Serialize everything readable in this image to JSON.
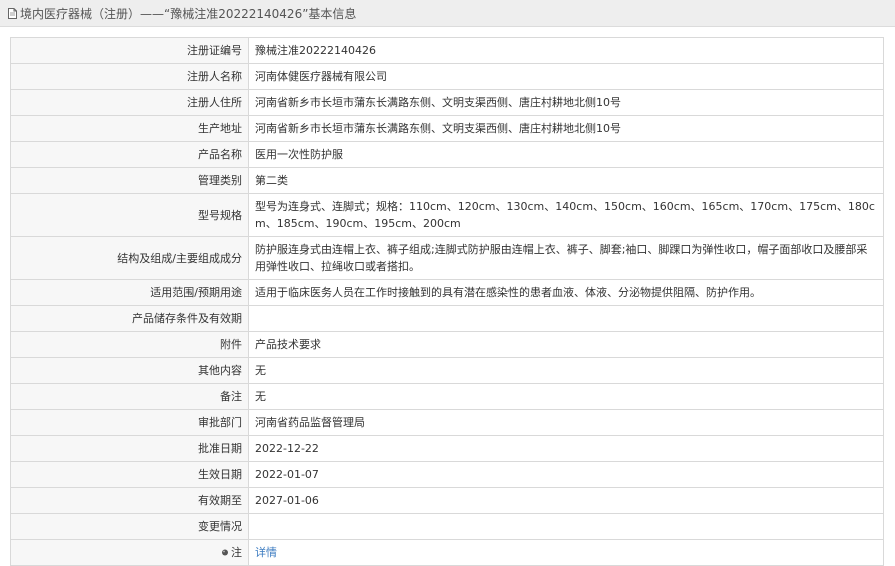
{
  "header": {
    "title": "境内医疗器械（注册）——“豫械注准20222140426”基本信息"
  },
  "rows": [
    {
      "label": "注册证编号",
      "value": "豫械注准20222140426"
    },
    {
      "label": "注册人名称",
      "value": "河南体健医疗器械有限公司"
    },
    {
      "label": "注册人住所",
      "value": "河南省新乡市长垣市蒲东长满路东侧、文明支渠西侧、唐庄村耕地北侧10号"
    },
    {
      "label": "生产地址",
      "value": "河南省新乡市长垣市蒲东长满路东侧、文明支渠西侧、唐庄村耕地北侧10号"
    },
    {
      "label": "产品名称",
      "value": "医用一次性防护服"
    },
    {
      "label": "管理类别",
      "value": "第二类"
    },
    {
      "label": "型号规格",
      "value": "型号为连身式、连脚式；规格：110cm、120cm、130cm、140cm、150cm、160cm、165cm、170cm、175cm、180cm、185cm、190cm、195cm、200cm"
    },
    {
      "label": "结构及组成/主要组成成分",
      "value": "防护服连身式由连帽上衣、裤子组成;连脚式防护服由连帽上衣、裤子、脚套;袖口、脚踝口为弹性收口，帽子面部收口及腰部采用弹性收口、拉绳收口或者搭扣。"
    },
    {
      "label": "适用范围/预期用途",
      "value": "适用于临床医务人员在工作时接触到的具有潜在感染性的患者血液、体液、分泌物提供阻隔、防护作用。"
    },
    {
      "label": "产品储存条件及有效期",
      "value": ""
    },
    {
      "label": "附件",
      "value": "产品技术要求"
    },
    {
      "label": "其他内容",
      "value": "无"
    },
    {
      "label": "备注",
      "value": "无"
    },
    {
      "label": "审批部门",
      "value": "河南省药品监督管理局"
    },
    {
      "label": "批准日期",
      "value": "2022-12-22"
    },
    {
      "label": "生效日期",
      "value": "2022-01-07"
    },
    {
      "label": "有效期至",
      "value": "2027-01-06"
    },
    {
      "label": "变更情况",
      "value": ""
    }
  ],
  "note_row": {
    "label": "注",
    "link_text": "详情"
  },
  "colors": {
    "link": "#3a7ac0",
    "header_bg": "#eeeeee",
    "border": "#d9d9d9"
  }
}
